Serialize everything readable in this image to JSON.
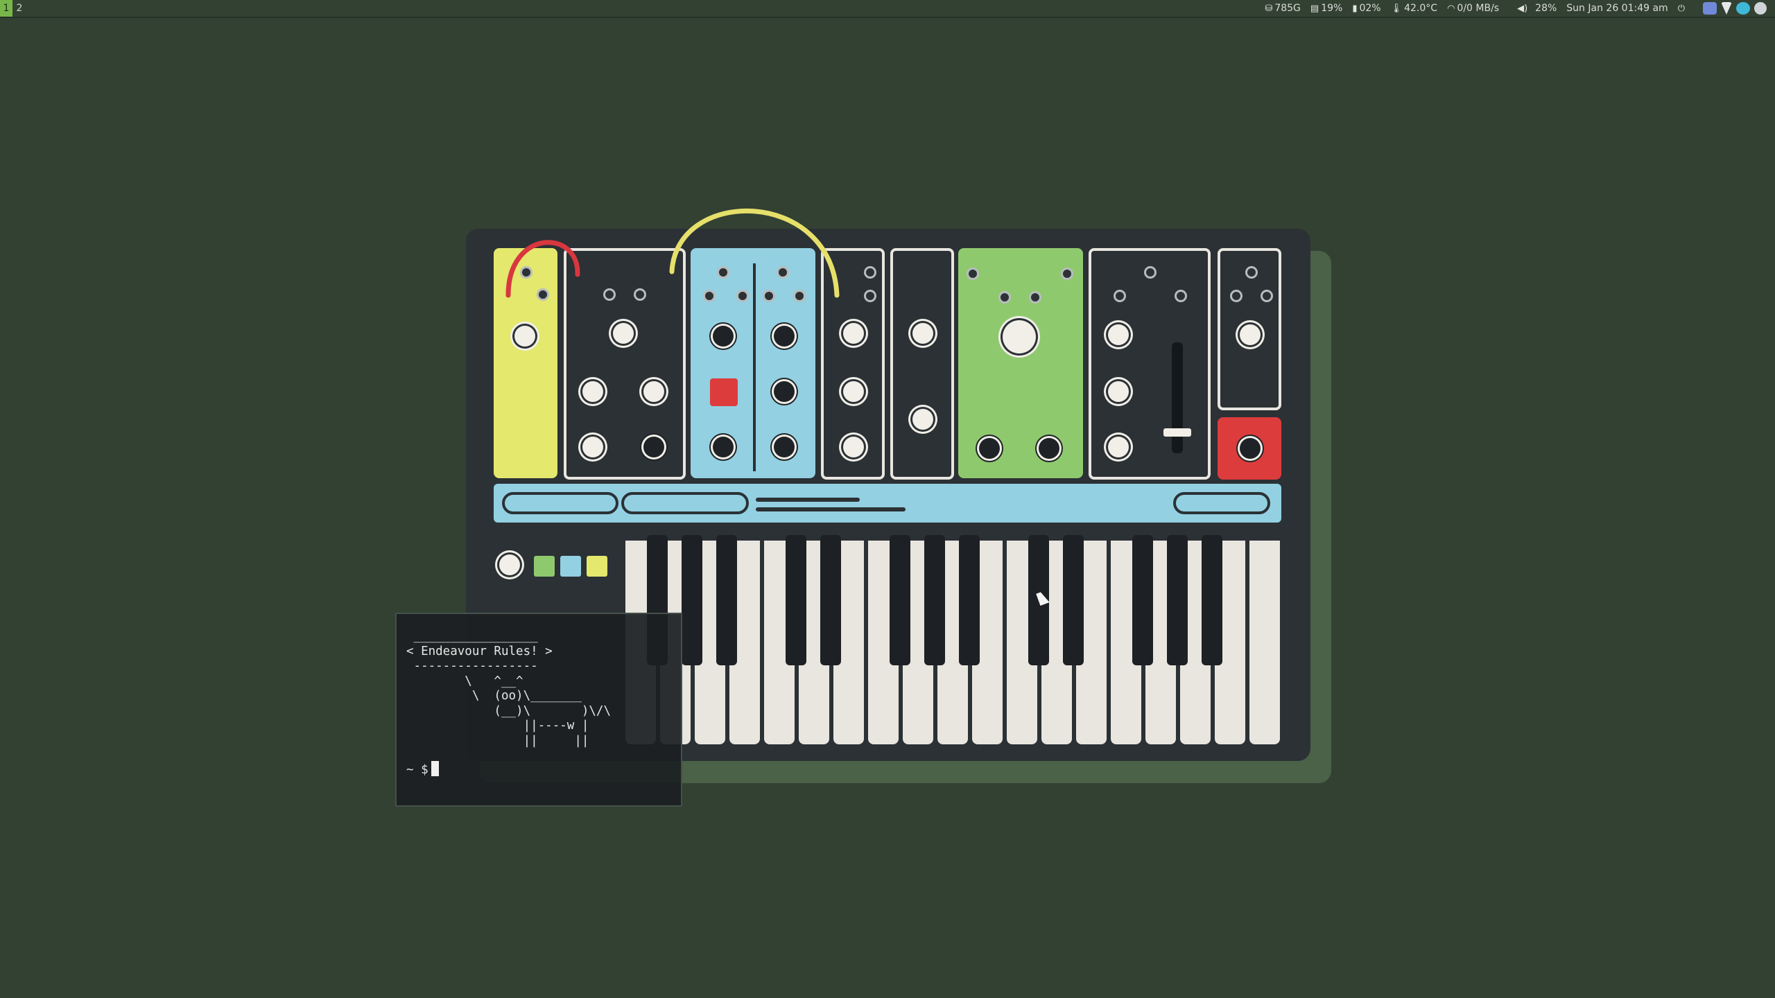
{
  "topbar": {
    "workspaces": [
      {
        "label": "1",
        "active": true
      },
      {
        "label": "2",
        "active": false
      }
    ],
    "status": {
      "disk": "785G",
      "memory": "19%",
      "battery": "02%",
      "temperature": "42.0°C",
      "network": "0/0 MB/s",
      "volume": "28%",
      "datetime": "Sun Jan 26 01:49 am"
    },
    "icons": [
      "disk-icon",
      "memory-icon",
      "battery-icon",
      "thermometer-icon",
      "wifi-icon",
      "volume-icon",
      "power-icon"
    ],
    "tray": [
      {
        "name": "discord-tray-icon",
        "color": "#7289da"
      },
      {
        "name": "network-tray-icon",
        "color": "#e8e8e8"
      },
      {
        "name": "update-tray-icon",
        "color": "#3fb8d8"
      },
      {
        "name": "steam-tray-icon",
        "color": "#d0d4d8"
      }
    ]
  },
  "wallpaper": {
    "colors": {
      "yellow": "#e4e86c",
      "blue": "#93d0e2",
      "green": "#8fc96e",
      "red": "#dd3c3c",
      "cable_red": "#d8373f",
      "cable_yellow": "#e6e06a"
    }
  },
  "terminal": {
    "cowsay": " _________________\n< Endeavour Rules! >\n -----------------\n        \\   ^__^\n         \\  (oo)\\_______\n            (__)\\       )\\/\\\n                ||----w |\n                ||     ||",
    "prompt": "~ $"
  }
}
